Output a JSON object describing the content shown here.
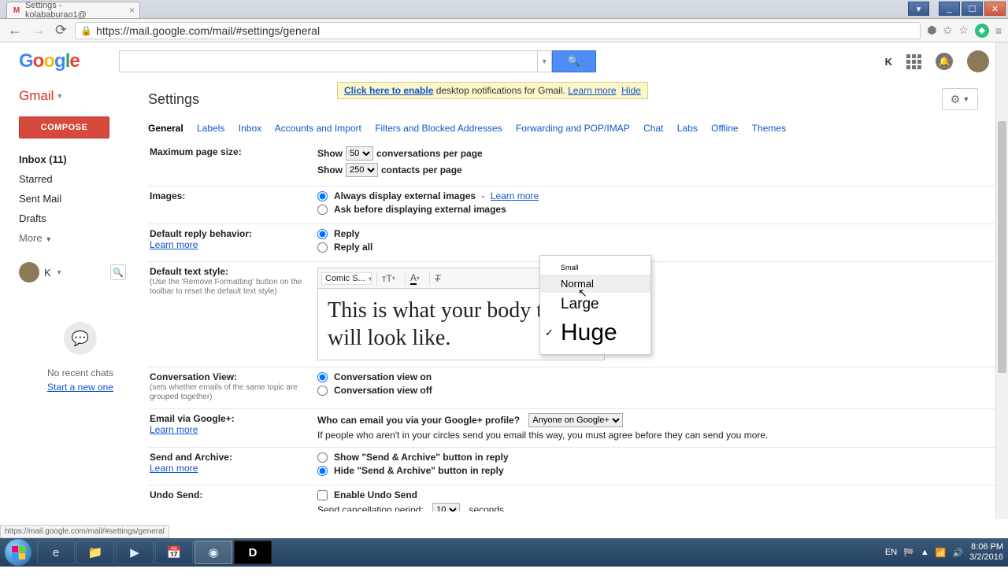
{
  "window": {
    "title": "Settings - kolababurao1@",
    "win_min": "_",
    "win_max": "☐",
    "win_close": "✕"
  },
  "browser": {
    "url": "https://mail.google.com/mail/#settings/general",
    "status_url": "https://mail.google.com/mail/#settings/general"
  },
  "header": {
    "logo": "Google",
    "user_initial": "K",
    "search_placeholder": ""
  },
  "notification": {
    "prefix": "Click here to enable",
    "text": " desktop notifications for Gmail.  ",
    "learn": "Learn more",
    "hide": "Hide"
  },
  "sidebar": {
    "product": "Gmail",
    "compose": "COMPOSE",
    "items": [
      "Inbox (11)",
      "Starred",
      "Sent Mail",
      "Drafts",
      "More"
    ],
    "user_label": "K",
    "chat_empty": "No recent chats",
    "chat_link": "Start a new one"
  },
  "content": {
    "title": "Settings",
    "tabs": [
      "General",
      "Labels",
      "Inbox",
      "Accounts and Import",
      "Filters and Blocked Addresses",
      "Forwarding and POP/IMAP",
      "Chat",
      "Labs",
      "Offline",
      "Themes"
    ],
    "active_tab": 0,
    "page_size": {
      "label": "Maximum page size:",
      "show": "Show",
      "conv_val": "50",
      "conv_suffix": "conversations per page",
      "cont_val": "250",
      "cont_suffix": "contacts per page"
    },
    "images": {
      "label": "Images:",
      "opt1": "Always display external images",
      "learn": "Learn more",
      "opt2": "Ask before displaying external images"
    },
    "reply": {
      "label": "Default reply behavior:",
      "learn": "Learn more",
      "opt1": "Reply",
      "opt2": "Reply all"
    },
    "text_style": {
      "label": "Default text style:",
      "sub": "(Use the 'Remove Formatting' button on the toolbar to reset the default text style)",
      "font": "Comic S...",
      "preview": "This is what your body text will look like."
    },
    "size_menu": {
      "small": "Small",
      "normal": "Normal",
      "large": "Large",
      "huge": "Huge",
      "selected": "huge",
      "hover": "normal"
    },
    "conv_view": {
      "label": "Conversation View:",
      "sub": "(sets whether emails of the same topic are grouped together)",
      "opt1": "Conversation view on",
      "opt2": "Conversation view off"
    },
    "gplus": {
      "label": "Email via Google+:",
      "learn": "Learn more",
      "q": "Who can email you via your Google+ profile?",
      "sel": "Anyone on Google+",
      "note": "If people who aren't in your circles send you email this way, you must agree before they can send you more."
    },
    "send_archive": {
      "label": "Send and Archive:",
      "learn": "Learn more",
      "opt1": "Show \"Send & Archive\" button in reply",
      "opt2": "Hide \"Send & Archive\" button in reply"
    },
    "undo": {
      "label": "Undo Send:",
      "chk": "Enable Undo Send",
      "period_label": "Send cancellation period:",
      "period_val": "10",
      "period_suffix": "seconds"
    }
  },
  "taskbar": {
    "lang": "EN",
    "time": "8:06 PM",
    "date": "3/2/2016"
  }
}
